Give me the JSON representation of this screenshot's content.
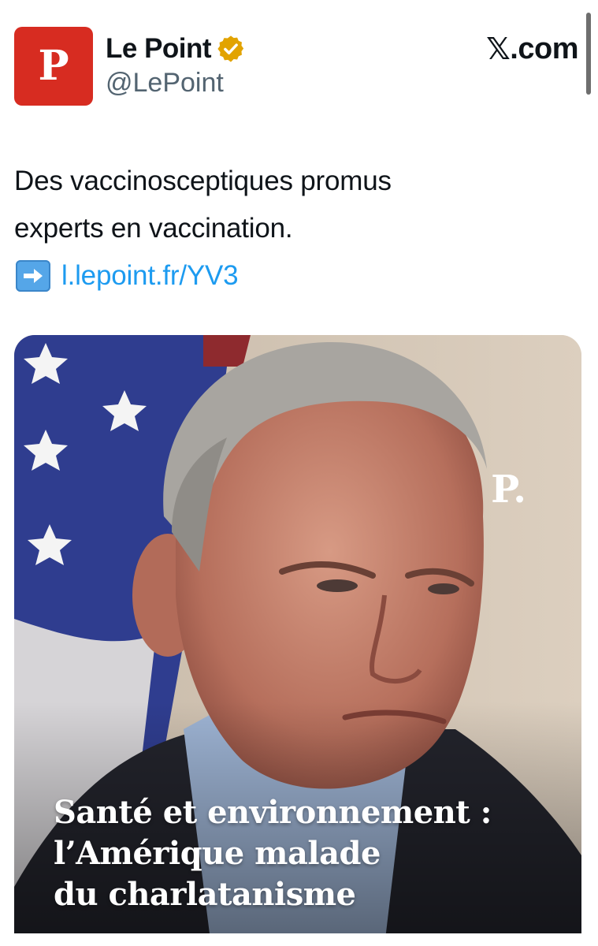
{
  "account": {
    "display_name": "Le Point",
    "handle": "@LePoint",
    "avatar_letter": "P",
    "verified_badge_color": "#e2a300"
  },
  "brand": {
    "site": "com",
    "x_glyph": "𝕏"
  },
  "tweet": {
    "text_line1": "Des vaccinosceptiques promus",
    "text_line2": "experts en vaccination.",
    "link_icon": "right-arrow-emoji-icon",
    "link_text": "l.lepoint.fr/YV3"
  },
  "media": {
    "watermark": "P.",
    "headline_line1": "Santé et environnement :",
    "headline_line2": "l’Amérique malade",
    "headline_line3": "du charlatanisme"
  },
  "colors": {
    "avatar_red": "#d72c21",
    "link_blue": "#1d9bf0",
    "handle_gray": "#536471"
  }
}
